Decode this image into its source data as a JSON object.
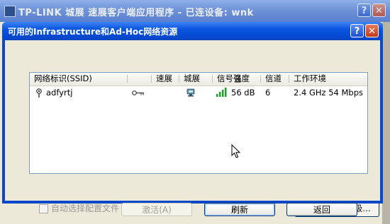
{
  "parent_window": {
    "title": "TP-LINK 城展  速展客户端应用程序 - 已连设备: wnk",
    "checkbox_label": "自动选择配置文件",
    "button_label": "配置文件优先级..."
  },
  "dialog": {
    "title": "可用的Infrastructure和Ad-Hoc网络资源",
    "columns": {
      "ssid": "网络标识(SSID)",
      "speed": "速展",
      "domain": "城展",
      "signal": "信号强度",
      "channel": "信道",
      "environment": "工作环境"
    },
    "networks": [
      {
        "ssid": "adfyrtj",
        "signal": "56 dB",
        "channel": "6",
        "environment": "2.4 GHz 54 Mbps",
        "signal_bars": 4,
        "secured": true
      }
    ],
    "buttons": {
      "activate": "激活(A)",
      "refresh": "刷新",
      "back": "返回"
    }
  },
  "colors": {
    "title_bar": "#0a55e0",
    "signal_green": "#1aa32a"
  },
  "icons": {
    "help": "?",
    "close": "✕"
  }
}
